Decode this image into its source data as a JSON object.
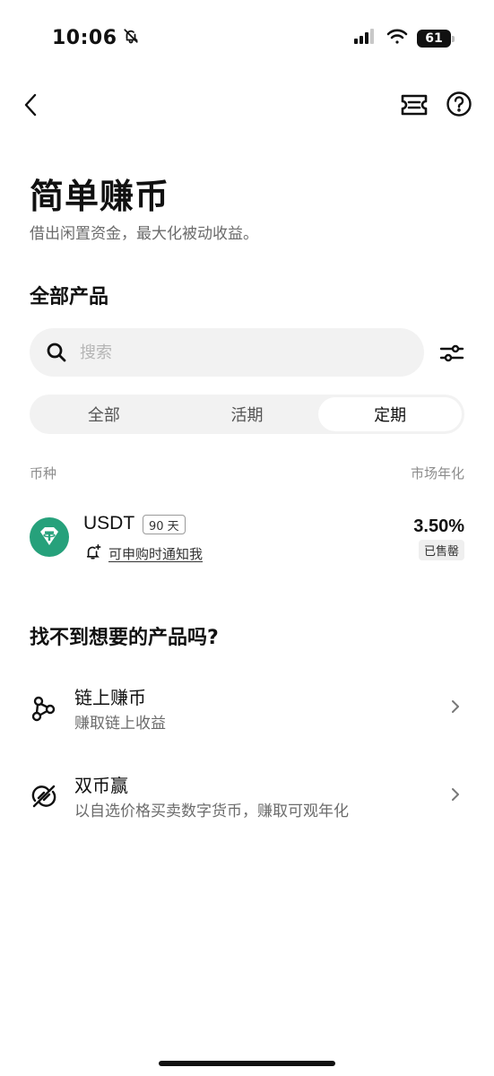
{
  "status": {
    "time": "10:06",
    "battery": "61"
  },
  "icons": {
    "bell_muted": "bell-slash-icon",
    "signal": "signal-icon",
    "wifi": "wifi-icon",
    "back": "chevron-left-icon",
    "coupon": "ticket-icon",
    "help": "question-circle-icon",
    "search": "search-icon",
    "filter": "sliders-icon",
    "coin": "tether-icon",
    "notify": "bell-plus-icon",
    "onchain": "nodes-icon",
    "dual": "dual-coin-icon",
    "chevron": "chevron-right-icon"
  },
  "header": {
    "title": "简单赚币",
    "subtitle": "借出闲置资金，最大化被动收益。"
  },
  "products": {
    "section_title": "全部产品",
    "search_placeholder": "搜索",
    "tabs": [
      {
        "label": "全部",
        "active": false
      },
      {
        "label": "活期",
        "active": false
      },
      {
        "label": "定期",
        "active": true
      }
    ],
    "column_coin": "币种",
    "column_apy": "市场年化",
    "items": [
      {
        "coin": "USDT",
        "term": "90 天",
        "notify": "可申购时通知我",
        "apy": "3.50%",
        "status": "已售罄"
      }
    ]
  },
  "others": {
    "section_title": "找不到想要的产品吗?",
    "items": [
      {
        "title": "链上赚币",
        "subtitle": "赚取链上收益"
      },
      {
        "title": "双币赢",
        "subtitle": "以自选价格买卖数字货币，赚取可观年化"
      }
    ]
  },
  "colors": {
    "tether": "#26a17b",
    "surface": "#f2f2f2",
    "text": "#111111",
    "muted": "#6b6b6b"
  }
}
